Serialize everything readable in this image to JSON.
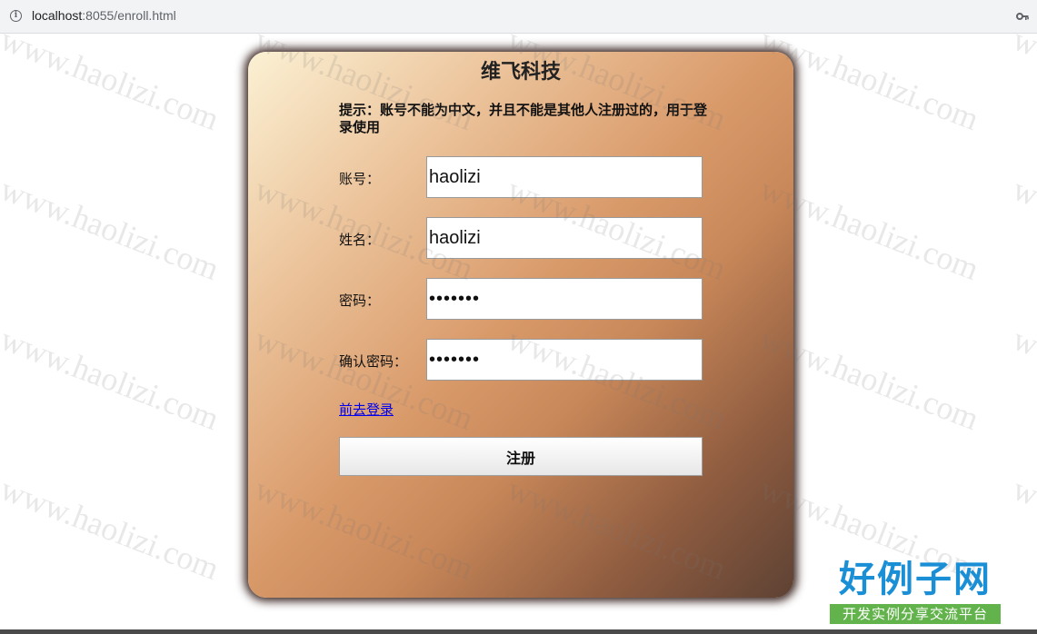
{
  "browser": {
    "url_host": "localhost",
    "url_path": ":8055/enroll.html"
  },
  "card": {
    "title": "维飞科技",
    "hint": "提示：账号不能为中文，并且不能是其他人注册过的，用于登录使用",
    "account_label": "账号：",
    "account_value": "haolizi",
    "name_label": "姓名：",
    "name_value": "haolizi",
    "password_label": "密码：",
    "password_value": "•••••••",
    "confirm_label": "确认密码：",
    "confirm_value": "•••••••",
    "login_link": "前去登录",
    "submit_label": "注册"
  },
  "watermark": {
    "text": "www.haolizi.com"
  },
  "logo": {
    "main": "好例子网",
    "sub": "开发实例分享交流平台"
  },
  "colors": {
    "card_gradient_start": "#fbf1d4",
    "card_gradient_end": "#5e4234",
    "link": "#0000ee",
    "logo_blue": "#1a8fd6",
    "logo_green": "#62b34c"
  }
}
